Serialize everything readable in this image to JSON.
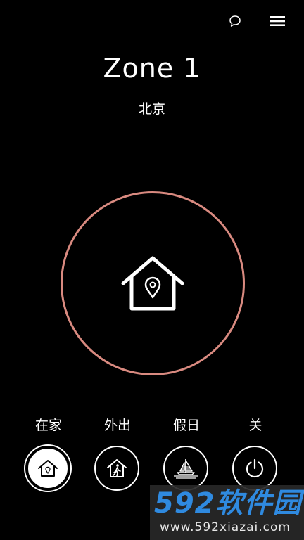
{
  "header": {
    "chat_icon": "chat-bubble-icon",
    "menu_icon": "hamburger-menu-icon"
  },
  "zone": {
    "title": "Zone 1",
    "city": "北京"
  },
  "status": {
    "icon": "home-location-icon",
    "ring_color": "#d98a80"
  },
  "modes": [
    {
      "label": "在家",
      "icon": "home-location-icon",
      "selected": true
    },
    {
      "label": "外出",
      "icon": "away-walking-icon",
      "selected": false
    },
    {
      "label": "假日",
      "icon": "holiday-sailboat-icon",
      "selected": false
    },
    {
      "label": "关",
      "icon": "power-icon",
      "selected": false
    }
  ],
  "watermark": {
    "brand": "592软件园",
    "url": "www.592xiazai.com",
    "color": "#2f8ae0"
  }
}
